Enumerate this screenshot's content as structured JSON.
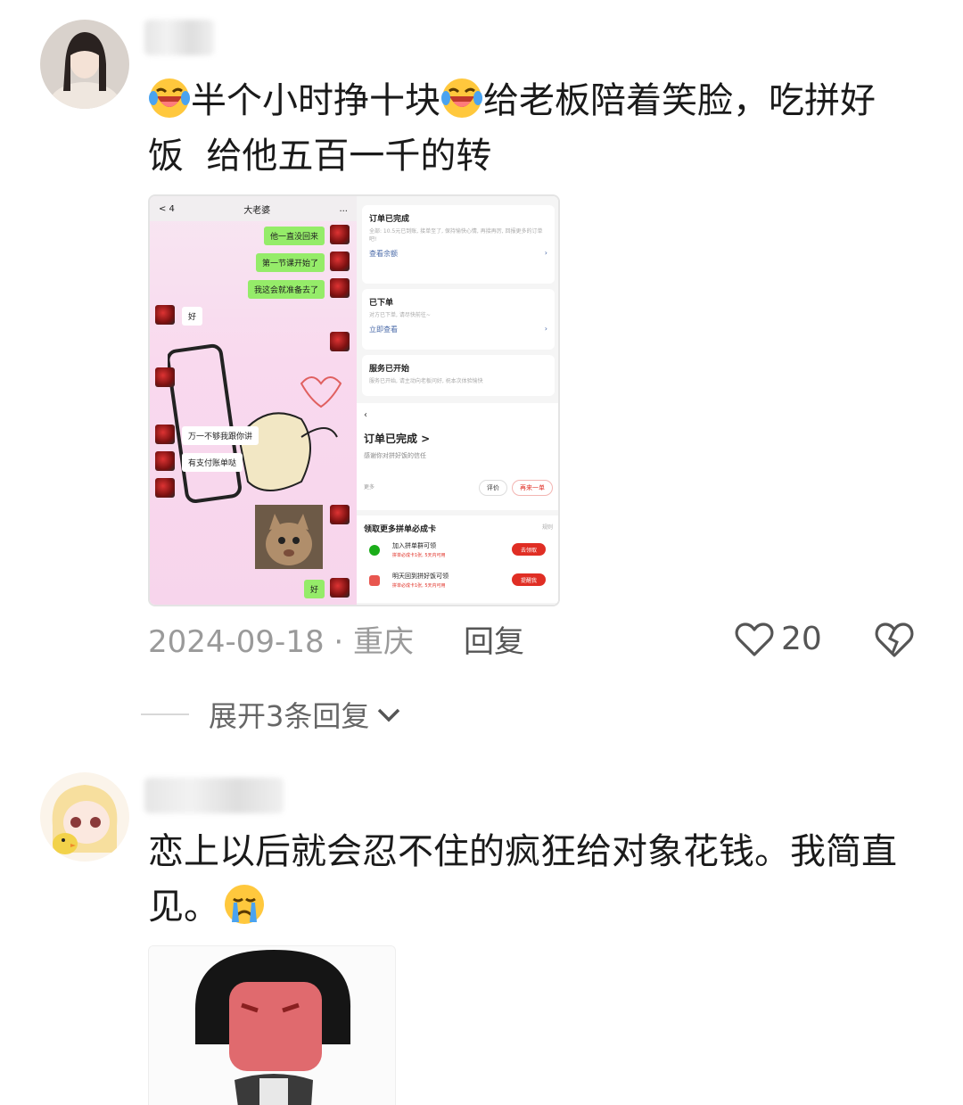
{
  "comments": [
    {
      "text_part1": "半个小时挣十块",
      "text_part2": "给老板陪着笑脸，吃拼好",
      "text_line2": "饭  给他五百一千的转",
      "date": "2024-09-18",
      "location": "重庆",
      "reply_label": "回复",
      "like_count": "20",
      "expand_label": "展开3条回复",
      "screenshot": {
        "chat_title": "大老婆",
        "chat_back": "< 4",
        "chat_menu": "...",
        "bubbles_right": [
          "他一直没回来",
          "第一节课开始了",
          "我这会就准备去了"
        ],
        "bubble_left_1": "好",
        "bubble_left_2": "万一不够我跟你讲",
        "bubble_left_3": "有支付账单哒",
        "bubble_right_last": "好",
        "order_card1_title": "订单已完成",
        "order_card1_desc": "全部: 10.5元已到账, 接单至了, 保持愉快心情, 再接再厉, 回报更多的订单吧!",
        "order_card1_link": "查看余额",
        "order_card2_title": "已下单",
        "order_card2_desc": "对方已下单, 请尽快前往~",
        "order_card2_link": "立即查看",
        "order_card3_title": "服务已开始",
        "order_card3_desc": "服务已开始, 请主动向老板问好, 祝本次体验愉快",
        "order_done_title": "订单已完成 >",
        "order_done_sub": "感谢你对拼好饭的信任",
        "more": "更多",
        "btn_review": "评价",
        "btn_again": "再来一单",
        "promo_title": "领取更多拼单必成卡",
        "promo_rule": "规则",
        "promo_item1": "加入拼单群可领",
        "promo_item1_sub": "拼单必成卡1张, 5天内可用",
        "promo_item1_btn": "去领取",
        "promo_item2": "明天回到拼好饭可领",
        "promo_item2_sub": "拼单必成卡1张, 5天内可用",
        "promo_item2_btn": "提醒我"
      }
    },
    {
      "text_line1": "恋上以后就会忍不住的疯狂给对象花钱。我简直",
      "text_line2": "见。"
    }
  ],
  "icons": {
    "like": "heart-outline-icon",
    "dislike": "broken-heart-icon",
    "expand": "chevron-down-icon",
    "emoji1": "laugh-cry-emoji",
    "emoji2": "crying-emoji"
  },
  "colors": {
    "meta_gray": "#9a9a9a",
    "chat_green": "#95ec69",
    "pdd_red": "#e02e24"
  }
}
